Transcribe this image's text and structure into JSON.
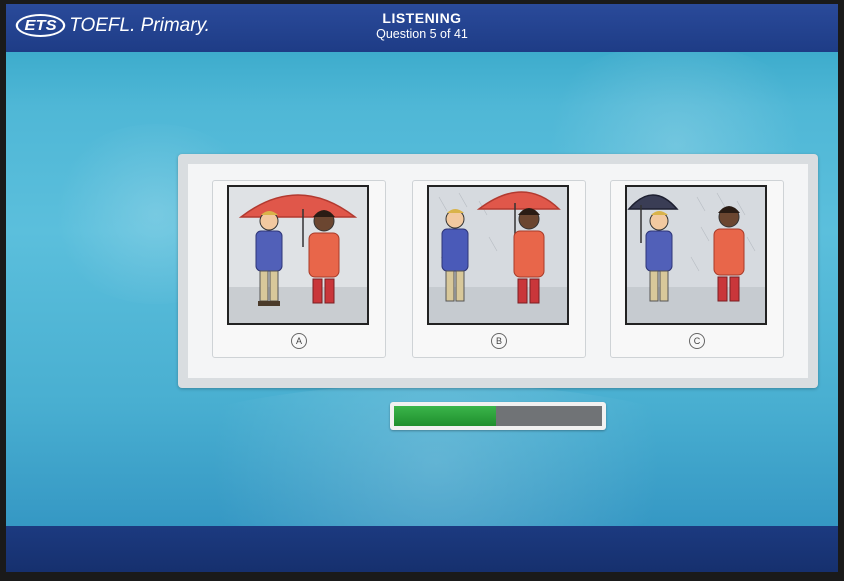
{
  "header": {
    "brand": "ETS",
    "product": "TOEFL. Primary.",
    "section": "LISTENING",
    "question_counter": "Question 5 of 41"
  },
  "choices": [
    {
      "label": "A",
      "description": "Both children under one red umbrella"
    },
    {
      "label": "B",
      "description": "Girl holding red umbrella, boy without"
    },
    {
      "label": "C",
      "description": "Boy holding dark umbrella, girl without"
    }
  ],
  "progress": {
    "fraction": 0.49
  },
  "colors": {
    "header": "#1e3c86",
    "background": "#4fb7d6",
    "progress_fill": "#2ea83d",
    "red_umbrella": "#e0574a",
    "dark_umbrella": "#3a3d55"
  }
}
